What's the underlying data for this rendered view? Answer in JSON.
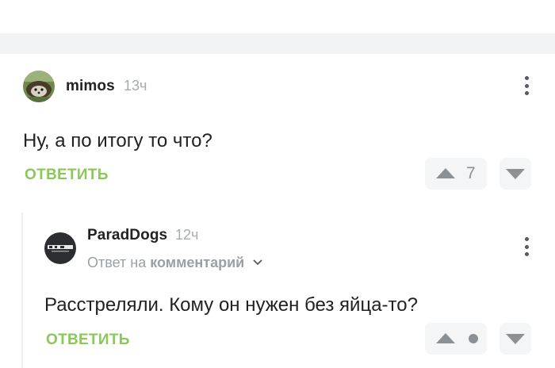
{
  "comments": [
    {
      "author": "mimos",
      "time": "13ч",
      "text": "Ну, а по итогу то что?",
      "reply_label": "Ответить",
      "score": "7",
      "avatar_icon": "hedgehog-avatar"
    },
    {
      "author": "ParadDogs",
      "time": "12ч",
      "reply_prefix": "Ответ на",
      "reply_link": "комментарий",
      "text": "Расстреляли. Кому он нужен без яйца-то?",
      "reply_label": "Ответить",
      "score_hidden": true,
      "avatar_icon": "dark-logo-avatar"
    }
  ],
  "colors": {
    "accent_green": "#8ac858",
    "muted_gray": "#a7abb0",
    "vote_bg": "#f4f5f7",
    "band_bg": "#f2f3f5"
  }
}
